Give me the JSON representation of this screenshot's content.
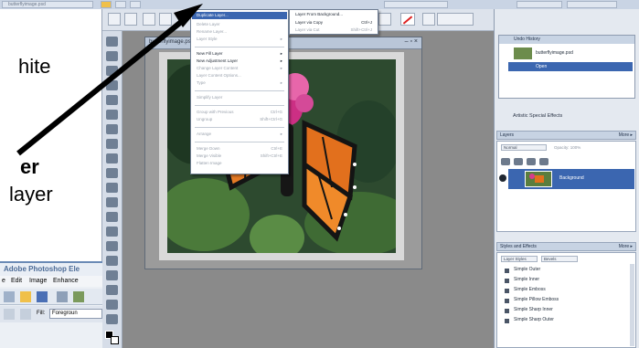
{
  "top_strip": {
    "file_tab": "butterflyimage.psd"
  },
  "instruction": {
    "line1": "hite",
    "line2": "er",
    "line3": "layer"
  },
  "document": {
    "title": "butterflyimage.psd"
  },
  "layer_menu": {
    "items": [
      {
        "label": "Duplicate Layer...",
        "shortcut": "",
        "disabled": false
      },
      {
        "label": "Delete Layer",
        "shortcut": "",
        "disabled": true
      },
      {
        "label": "Rename Layer...",
        "shortcut": "",
        "disabled": true
      },
      {
        "label": "Layer Style",
        "shortcut": "",
        "disabled": true
      },
      {
        "label": "New Fill Layer",
        "shortcut": "",
        "disabled": false
      },
      {
        "label": "New Adjustment Layer",
        "shortcut": "",
        "disabled": false
      },
      {
        "label": "Change Layer Content",
        "shortcut": "",
        "disabled": true
      },
      {
        "label": "Layer Content Options...",
        "shortcut": "",
        "disabled": true
      },
      {
        "label": "Type",
        "shortcut": "",
        "disabled": true
      },
      {
        "label": "Simplify Layer",
        "shortcut": "",
        "disabled": true
      },
      {
        "label": "Group with Previous",
        "shortcut": "Ctrl+G",
        "disabled": true
      },
      {
        "label": "Ungroup",
        "shortcut": "Shift+Ctrl+G",
        "disabled": true
      },
      {
        "label": "Arrange",
        "shortcut": "",
        "disabled": true
      },
      {
        "label": "Merge Down",
        "shortcut": "Ctrl+E",
        "disabled": true
      },
      {
        "label": "Merge Visible",
        "shortcut": "Shift+Ctrl+E",
        "disabled": true
      },
      {
        "label": "Flatten Image",
        "shortcut": "",
        "disabled": true
      }
    ]
  },
  "new_layer_submenu": {
    "items": [
      {
        "label": "Layer From Background...",
        "shortcut": "",
        "disabled": false
      },
      {
        "label": "Layer via Copy",
        "shortcut": "Ctrl+J",
        "disabled": false
      },
      {
        "label": "Layer via Cut",
        "shortcut": "Shift+Ctrl+J",
        "disabled": true
      }
    ]
  },
  "right_panel": {
    "undo_history": {
      "tab": "Undo History",
      "items": [
        "butterflyimage.psd",
        "Open"
      ]
    },
    "effects_label": "Artistic Special Effects",
    "layers": {
      "title": "Layers",
      "more": "More ▸",
      "mode": "Normal",
      "opacity": "Opacity: 100%",
      "layer_name": "Background"
    },
    "styles": {
      "title": "Styles and Effects",
      "more": "More ▸",
      "category": "Layer Styles",
      "subcategory": "Bevels",
      "items": [
        "Simple Outer",
        "Simple Inner",
        "Simple Emboss",
        "Simple Pillow Emboss",
        "Simple Sharp Inner",
        "Simple Sharp Outer"
      ]
    }
  },
  "app_window": {
    "title": "Adobe Photoshop Ele",
    "menus": [
      "e",
      "Edit",
      "Image",
      "Enhance"
    ],
    "fill_label": "Fill:",
    "fill_value": "Foregroun"
  },
  "colors": {
    "menu_highlight": "#3b66b0",
    "panel_selection": "#3b66b0",
    "arrow": "#000000",
    "app_title": "#4d6c97"
  }
}
